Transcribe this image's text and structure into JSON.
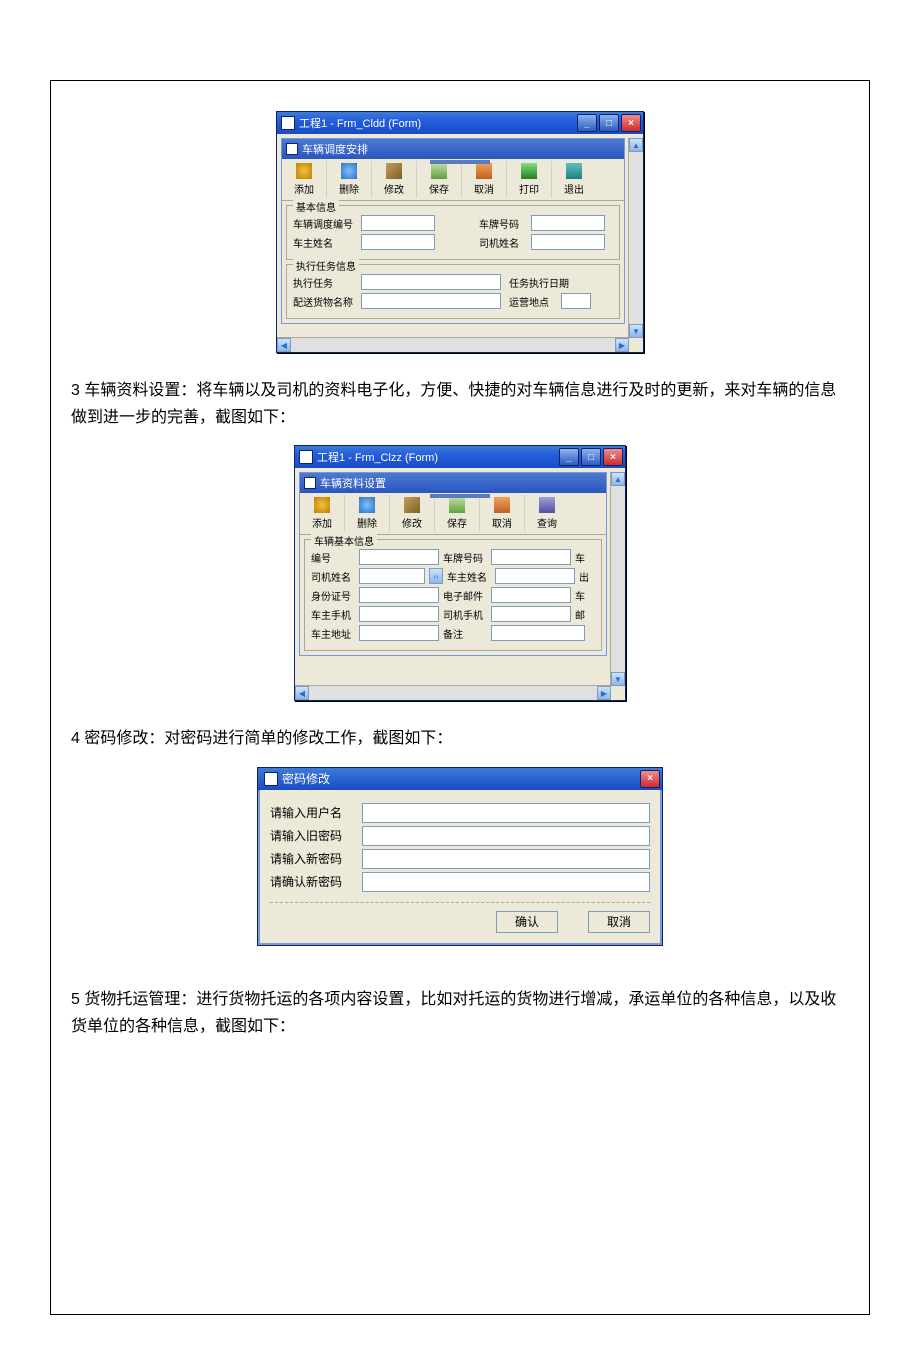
{
  "win1": {
    "outer_title": "工程1 - Frm_Cldd (Form)",
    "inner_title": "车辆调度安排",
    "toolbar": [
      {
        "label": "添加",
        "ico": "ico-add"
      },
      {
        "label": "删除",
        "ico": "ico-del"
      },
      {
        "label": "修改",
        "ico": "ico-mod"
      },
      {
        "label": "保存",
        "ico": "ico-save"
      },
      {
        "label": "取消",
        "ico": "ico-cancel"
      },
      {
        "label": "打印",
        "ico": "ico-print"
      },
      {
        "label": "退出",
        "ico": "ico-exit"
      }
    ],
    "group1_title": "基本信息",
    "g1_labels": {
      "a": "车辆调度编号",
      "b": "车牌号码",
      "c": "车主姓名",
      "d": "司机姓名"
    },
    "group2_title": "执行任务信息",
    "g2_labels": {
      "a": "执行任务",
      "b": "任务执行日期",
      "c": "配送货物名称",
      "d": "运营地点"
    }
  },
  "para3": "3 车辆资料设置：将车辆以及司机的资料电子化，方便、快捷的对车辆信息进行及时的更新，来对车辆的信息做到进一步的完善，截图如下：",
  "win2": {
    "outer_title": "工程1 - Frm_Clzz (Form)",
    "inner_title": "车辆资料设置",
    "toolbar": [
      {
        "label": "添加",
        "ico": "ico-add"
      },
      {
        "label": "删除",
        "ico": "ico-del"
      },
      {
        "label": "修改",
        "ico": "ico-mod"
      },
      {
        "label": "保存",
        "ico": "ico-save"
      },
      {
        "label": "取消",
        "ico": "ico-cancel"
      },
      {
        "label": "查询",
        "ico": "ico-query"
      }
    ],
    "group_title": "车辆基本信息",
    "labels": {
      "r1a": "编号",
      "r1b": "车牌号码",
      "r1c": "车",
      "r2a": "司机姓名",
      "r2b": "车主姓名",
      "r2c": "出",
      "r3a": "身份证号",
      "r3b": "电子邮件",
      "r3c": "车",
      "r4a": "车主手机",
      "r4b": "司机手机",
      "r4c": "邮",
      "r5a": "车主地址",
      "r5b": "备注"
    }
  },
  "para4": "4 密码修改：对密码进行简单的修改工作，截图如下：",
  "win3": {
    "title": "密码修改",
    "labels": {
      "a": "请输入用户名",
      "b": "请输入旧密码",
      "c": "请输入新密码",
      "d": "请确认新密码"
    },
    "ok": "确认",
    "cancel": "取消"
  },
  "para5": "5 货物托运管理：进行货物托运的各项内容设置，比如对托运的货物进行增减，承运单位的各种信息，以及收货单位的各种信息，截图如下："
}
